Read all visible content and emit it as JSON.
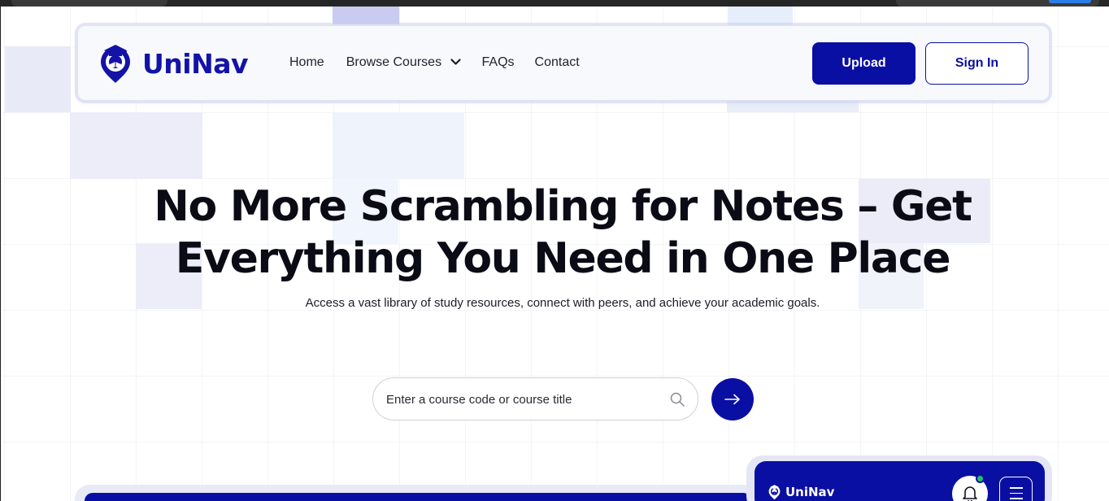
{
  "brand": {
    "name": "UniNav",
    "color": "#1313a8"
  },
  "nav": {
    "items": [
      {
        "label": "Home"
      },
      {
        "label": "Browse Courses"
      },
      {
        "label": "FAQs"
      },
      {
        "label": "Contact"
      }
    ],
    "upload_label": "Upload",
    "signin_label": "Sign In"
  },
  "hero": {
    "title_line1": "No More Scrambling for Notes – Get",
    "title_line2": "Everything You Need in One Place",
    "subtitle": "Access a vast library of study resources, connect with peers, and achieve your academic goals."
  },
  "search": {
    "placeholder": "Enter a course code or course title",
    "icon": "search-icon",
    "submit_icon": "arrow-right-icon"
  },
  "preview": {
    "brand": "UniNav",
    "notification_icon": "bell-icon",
    "menu_icon": "hamburger-menu-icon",
    "notification_dot_color": "#22c55e"
  },
  "colors": {
    "primary": "#0a0fa3",
    "accent_light": "#e8eaf6"
  }
}
